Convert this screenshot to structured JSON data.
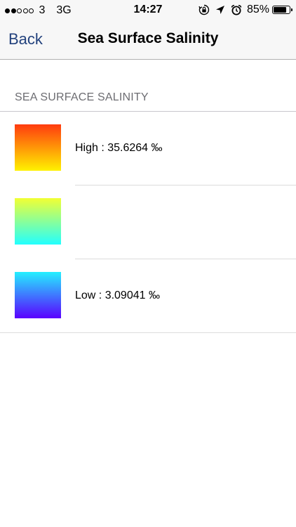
{
  "status_bar": {
    "signal_dots": [
      "filled",
      "filled",
      "empty",
      "empty",
      "empty"
    ],
    "carrier": "3",
    "network": "3G",
    "time": "14:27",
    "battery_percent": "85%",
    "battery_level": 0.85,
    "icons": [
      "orientation-lock-icon",
      "location-arrow-icon",
      "alarm-clock-icon"
    ]
  },
  "nav": {
    "back_label": "Back",
    "title": "Sea Surface Salinity"
  },
  "section": {
    "header": "SEA SURFACE SALINITY"
  },
  "legend": [
    {
      "label": "High : 35.6264 ‰",
      "gradient_top": "#ff3b0f",
      "gradient_bottom": "#fff200"
    },
    {
      "label": "",
      "gradient_top": "#f2ff33",
      "gradient_bottom": "#22ffff"
    },
    {
      "label": "Low : 3.09041 ‰",
      "gradient_top": "#24f0ff",
      "gradient_bottom": "#5a00ff"
    }
  ],
  "colors": {
    "accent": "#23427d",
    "section_header": "#6d6d72",
    "bar_background": "#f7f7f7"
  }
}
